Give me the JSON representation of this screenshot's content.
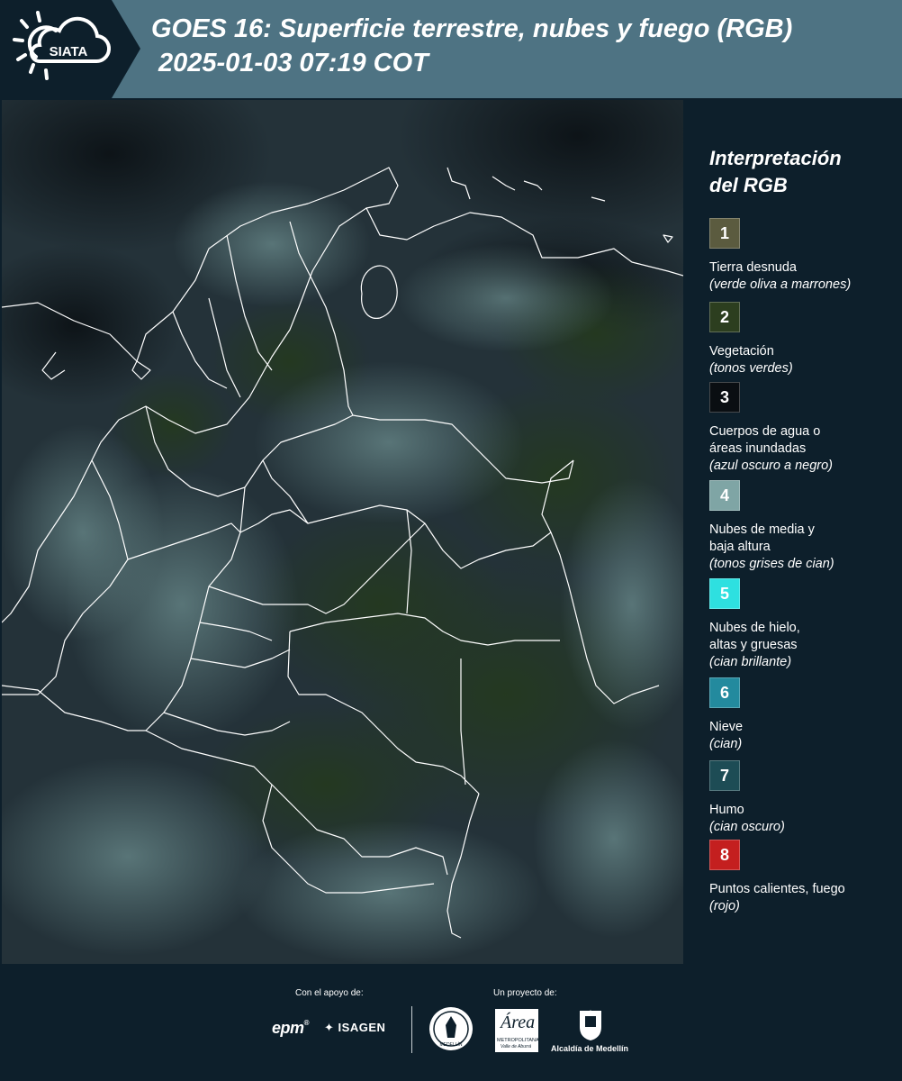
{
  "header": {
    "logo_text": "SIATA",
    "title_line1": "GOES 16: Superficie terrestre, nubes y fuego (RGB)",
    "title_line2": "2025-01-03 07:19 COT"
  },
  "legend": {
    "title_line1": "Interpretación",
    "title_line2": "del RGB",
    "items": [
      {
        "num": "1",
        "color": "#5b5b3f",
        "lines": [
          "Tierra desnuda"
        ],
        "note": "(verde oliva a marrones)"
      },
      {
        "num": "2",
        "color": "#2c3e1f",
        "lines": [
          "Vegetación"
        ],
        "note": "(tonos verdes)"
      },
      {
        "num": "3",
        "color": "#0a0e12",
        "lines": [
          "Cuerpos de agua o",
          "áreas inundadas"
        ],
        "note": "(azul oscuro a negro)"
      },
      {
        "num": "4",
        "color": "#7fa5a5",
        "lines": [
          "Nubes de media y",
          "baja altura"
        ],
        "note": "(tonos grises de cian)"
      },
      {
        "num": "5",
        "color": "#2ee0e0",
        "lines": [
          "Nubes de hielo,",
          "altas y gruesas"
        ],
        "note": "(cian brillante)"
      },
      {
        "num": "6",
        "color": "#238a9e",
        "lines": [
          "Nieve"
        ],
        "note": "(cian)"
      },
      {
        "num": "7",
        "color": "#1d4c55",
        "lines": [
          "Humo"
        ],
        "note": "(cian oscuro)"
      },
      {
        "num": "8",
        "color": "#c41f1f",
        "lines": [
          "Puntos calientes, fuego"
        ],
        "note": "(rojo)"
      }
    ]
  },
  "footer": {
    "support_label": "Con el apoyo de:",
    "project_label": "Un proyecto de:",
    "epm": "epm",
    "isagen": "ISAGEN",
    "area_script": "Área",
    "area_line1": "METROPOLITANA",
    "area_line2": "Valle de Aburrá",
    "alcaldia": "Alcaldía de Medellín",
    "seal_text": "MEDELLÍN"
  },
  "colors": {
    "header_bg": "#4e7383",
    "panel_bg": "#0d1f2b",
    "map_base": "#1d2a30",
    "cloud": "#7fa5a5",
    "vegetation": "#2c3e1f"
  }
}
